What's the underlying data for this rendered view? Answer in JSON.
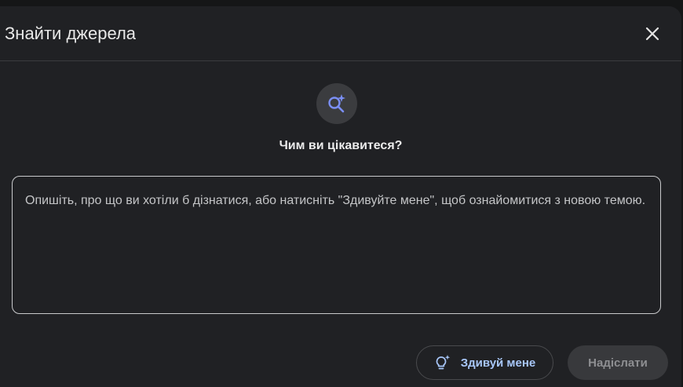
{
  "dialog": {
    "title": "Знайти джерела",
    "close_icon": "close-icon"
  },
  "prompt": {
    "icon": "sparkle-search-icon",
    "question": "Чим ви цікавитеся?",
    "placeholder": "Опишіть, про що ви хотіли б дізнатися, або натисніть \"Здивуйте мене\", щоб ознайомитися з новою темою."
  },
  "actions": {
    "surprise_icon": "lightbulb-sparkle-icon",
    "surprise_label": "Здивуй мене",
    "submit_label": "Надіслати"
  },
  "colors": {
    "background": "#202124",
    "accent": "#a8c7fa",
    "icon_accent": "#7b8ff5"
  }
}
